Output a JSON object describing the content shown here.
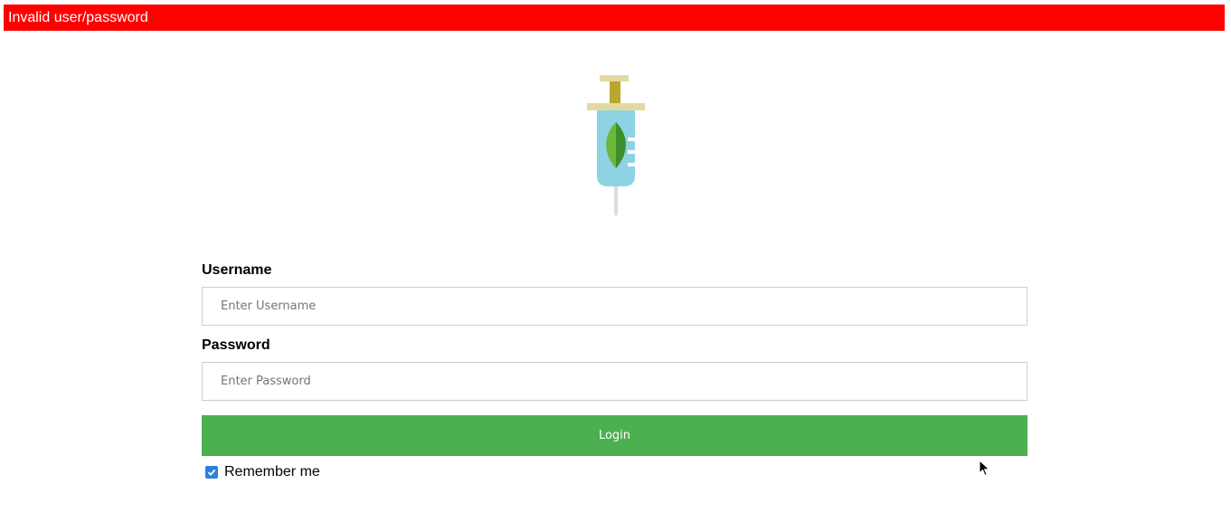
{
  "error_message": "Invalid user/password",
  "logo_icon": "syringe-leaf-icon",
  "form": {
    "username": {
      "label": "Username",
      "value": "",
      "placeholder": "Enter Username"
    },
    "password": {
      "label": "Password",
      "value": "",
      "placeholder": "Enter Password"
    },
    "login_label": "Login",
    "remember": {
      "label": "Remember me",
      "checked": true
    }
  },
  "colors": {
    "error": "#ff0000",
    "login_button": "#4caf50",
    "checkbox": "#2f7fdb"
  }
}
